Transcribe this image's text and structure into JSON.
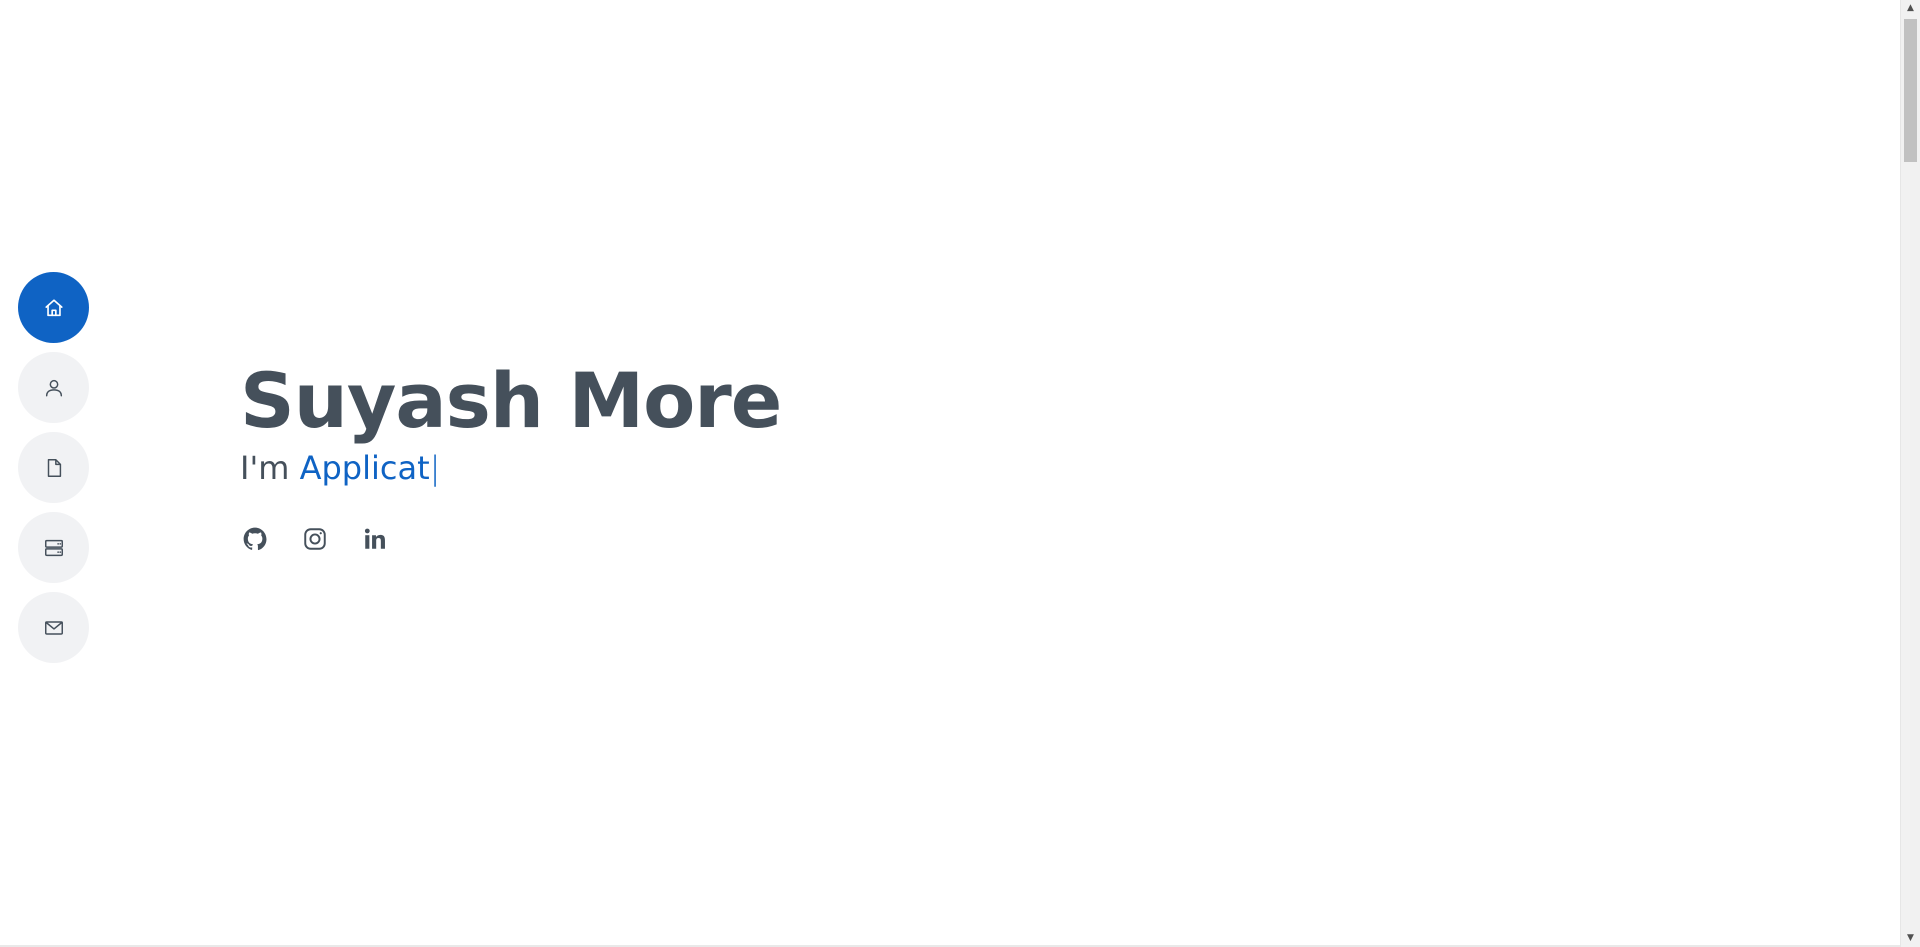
{
  "nav": {
    "items": [
      {
        "label": "Home",
        "icon": "home-icon",
        "active": true
      },
      {
        "label": "About",
        "icon": "person-icon",
        "active": false
      },
      {
        "label": "Resume",
        "icon": "file-icon",
        "active": false
      },
      {
        "label": "Services",
        "icon": "server-icon",
        "active": false
      },
      {
        "label": "Contact",
        "icon": "envelope-icon",
        "active": false
      }
    ]
  },
  "hero": {
    "name": "Suyash More",
    "prefix": "I'm ",
    "typed": "Applicat",
    "cursor": "|"
  },
  "social": [
    {
      "icon": "github-icon"
    },
    {
      "icon": "instagram-icon"
    },
    {
      "icon": "linkedin-icon"
    }
  ],
  "colors": {
    "accent": "#0f63c4",
    "text": "#45505b",
    "nav_bg": "#f1f2f4",
    "background": "#ffffff"
  }
}
